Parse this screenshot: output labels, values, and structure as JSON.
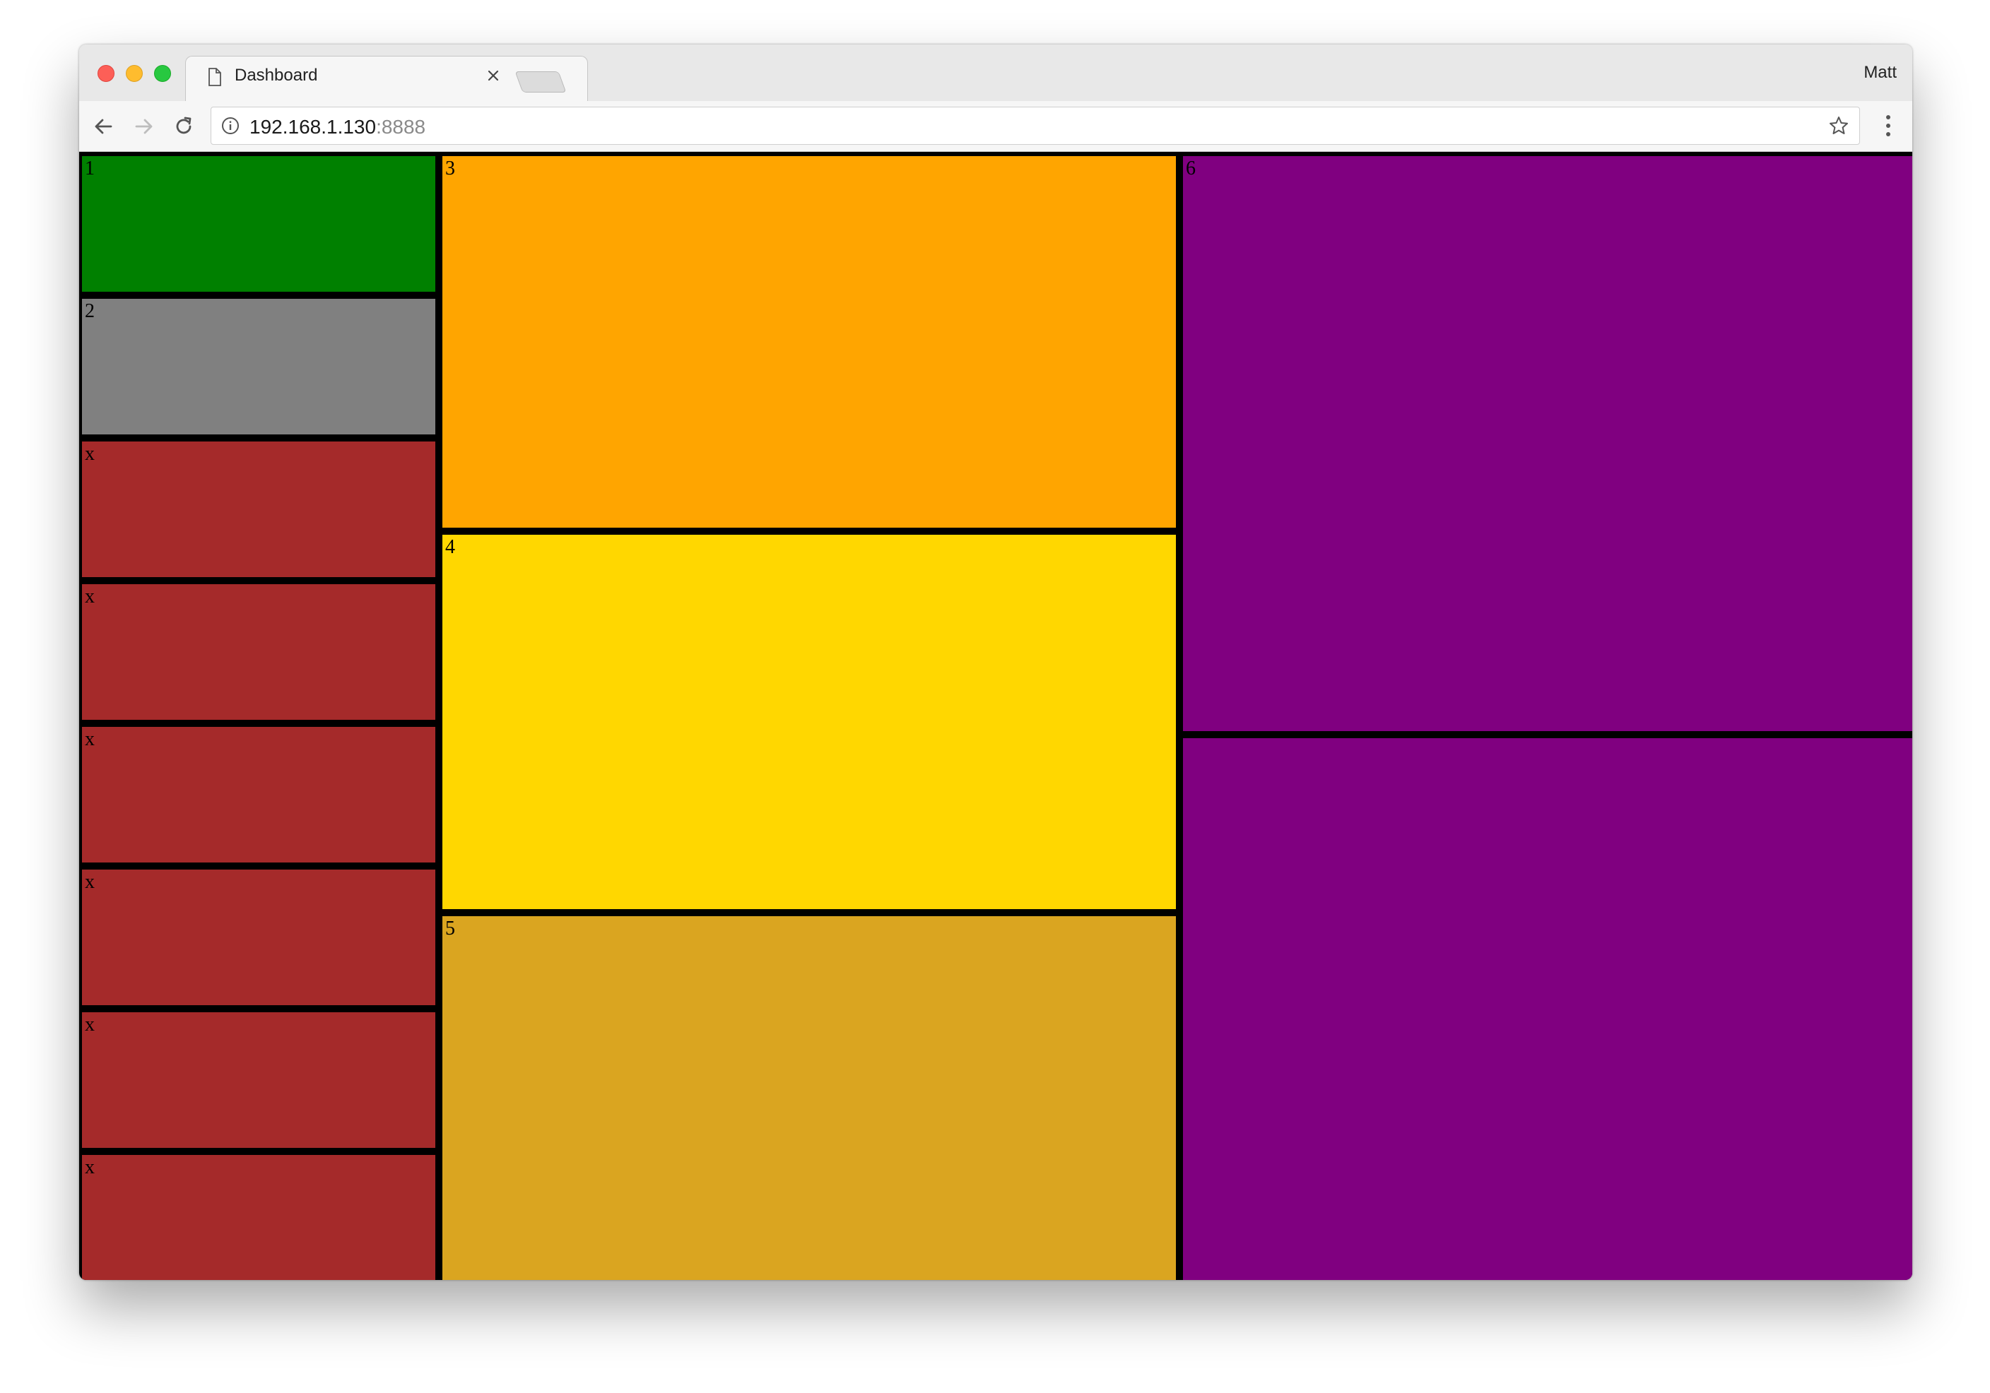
{
  "browser": {
    "tab_title": "Dashboard",
    "profile_name": "Matt",
    "url_host": "192.168.1.130",
    "url_port": ":8888"
  },
  "colors": {
    "green": "#008000",
    "gray": "#808080",
    "brown": "#a52a2a",
    "orange": "#ffa500",
    "gold": "#ffd700",
    "goldenrod": "#daa520",
    "purple": "#800080",
    "border": "#000000"
  },
  "dashboard": {
    "left_column": [
      {
        "label": "1",
        "color": "#008000"
      },
      {
        "label": "2",
        "color": "#808080"
      },
      {
        "label": "x",
        "color": "#a52a2a"
      },
      {
        "label": "x",
        "color": "#a52a2a"
      },
      {
        "label": "x",
        "color": "#a52a2a"
      },
      {
        "label": "x",
        "color": "#a52a2a"
      },
      {
        "label": "x",
        "color": "#a52a2a"
      },
      {
        "label": "x",
        "color": "#a52a2a"
      }
    ],
    "middle_column": [
      {
        "label": "3",
        "color": "#ffa500"
      },
      {
        "label": "4",
        "color": "#ffd700"
      },
      {
        "label": "5",
        "color": "#daa520"
      }
    ],
    "right_column": [
      {
        "label": "6",
        "color": "#800080"
      },
      {
        "label": "",
        "color": "#800080"
      }
    ]
  }
}
